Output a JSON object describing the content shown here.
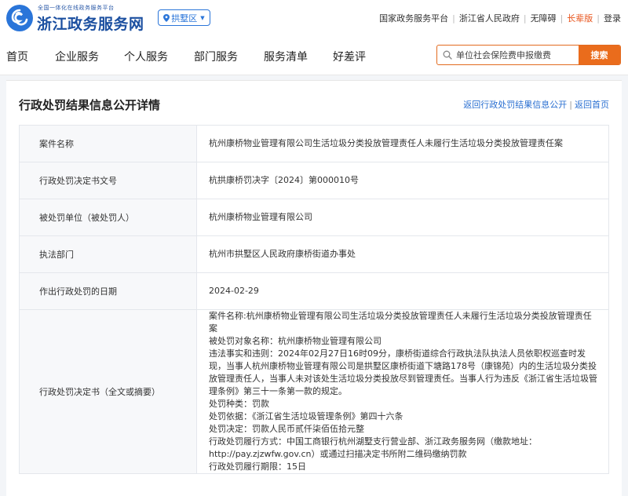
{
  "header": {
    "logo_subtitle": "全国一体化在线政务服务平台",
    "logo_title": "浙江政务服务网",
    "region": "拱墅区",
    "top_links": [
      {
        "label": "国家政务服务平台",
        "highlight": false
      },
      {
        "label": "浙江省人民政府",
        "highlight": false
      },
      {
        "label": "无障碍",
        "highlight": false
      },
      {
        "label": "长辈版",
        "highlight": true
      },
      {
        "label": "登录",
        "highlight": false
      }
    ],
    "brand_color": "#1b4fa0",
    "accent_color": "#ea6c1c"
  },
  "nav": {
    "items": [
      "首页",
      "企业服务",
      "个人服务",
      "部门服务",
      "服务清单",
      "好差评"
    ],
    "search_placeholder": "单位社会保险费申报缴费",
    "search_button": "搜索"
  },
  "page": {
    "title": "行政处罚结果信息公开详情",
    "back_link": "返回行政处罚结果信息公开",
    "home_link": "返回首页"
  },
  "rows": [
    {
      "key": "案件名称",
      "value": "杭州康桥物业管理有限公司生活垃圾分类投放管理责任人未履行生活垃圾分类投放管理责任案"
    },
    {
      "key": "行政处罚决定书文号",
      "value": "杭拱康桥罚决字〔2024〕第000010号"
    },
    {
      "key": "被处罚单位（被处罚人）",
      "value": "杭州康桥物业管理有限公司"
    },
    {
      "key": "执法部门",
      "value": "杭州市拱墅区人民政府康桥街道办事处"
    },
    {
      "key": "作出行政处罚的日期",
      "value": "2024-02-29"
    }
  ],
  "full_text": {
    "key": "行政处罚决定书（全文或摘要）",
    "lines": [
      "案件名称:杭州康桥物业管理有限公司生活垃圾分类投放管理责任人未履行生活垃圾分类投放管理责任案",
      "被处罚对象名称：杭州康桥物业管理有限公司",
      "违法事实和违则：2024年02月27日16时09分，康桥街道综合行政执法队执法人员依职权巡查时发现，当事人杭州康桥物业管理有限公司是拱墅区康桥街道下塘路178号（康锦苑）内的生活垃圾分类投放管理责任人，当事人未对该处生活垃圾分类投放尽到管理责任。当事人行为违反《浙江省生活垃圾管理条例》第三十一条第一款的规定。",
      "处罚种类：罚款",
      "处罚依据：《浙江省生活垃圾管理条例》第四十六条",
      "处罚决定：罚款人民币贰仟柒佰伍拾元整",
      "行政处罚履行方式：中国工商银行杭州湖墅支行营业部、浙江政务服务网（缴款地址：http://pay.zjzwfw.gov.cn）或通过扫描决定书所附二维码缴纳罚款",
      "行政处罚履行期限：15日"
    ]
  }
}
